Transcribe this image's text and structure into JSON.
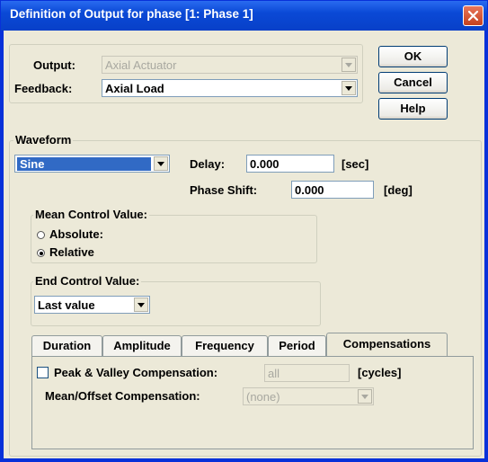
{
  "window": {
    "title": "Definition of Output for phase [1: Phase 1]"
  },
  "output": {
    "label": "Output:",
    "value": "Axial Actuator"
  },
  "feedback": {
    "label": "Feedback:",
    "value": "Axial Load"
  },
  "buttons": {
    "ok": "OK",
    "cancel": "Cancel",
    "help": "Help"
  },
  "waveform": {
    "group_label": "Waveform",
    "type_value": "Sine",
    "delay_label": "Delay:",
    "delay_value": "0.000",
    "delay_unit": "[sec]",
    "phase_label": "Phase Shift:",
    "phase_value": "0.000",
    "phase_unit": "[deg]"
  },
  "mean_control": {
    "group_label": "Mean Control Value:",
    "options": [
      {
        "label": "Absolute:",
        "checked": false
      },
      {
        "label": "Relative",
        "checked": true
      }
    ]
  },
  "end_control": {
    "group_label": "End Control Value:",
    "value": "Last value"
  },
  "tabs": [
    "Duration",
    "Amplitude",
    "Frequency",
    "Period",
    "Compensations"
  ],
  "active_tab": "Compensations",
  "compensations": {
    "peak_valley_label": "Peak & Valley Compensation:",
    "peak_valley_checked": false,
    "peak_valley_value": "all",
    "peak_valley_unit": "[cycles]",
    "mean_offset_label": "Mean/Offset Compensation:",
    "mean_offset_value": "(none)"
  }
}
